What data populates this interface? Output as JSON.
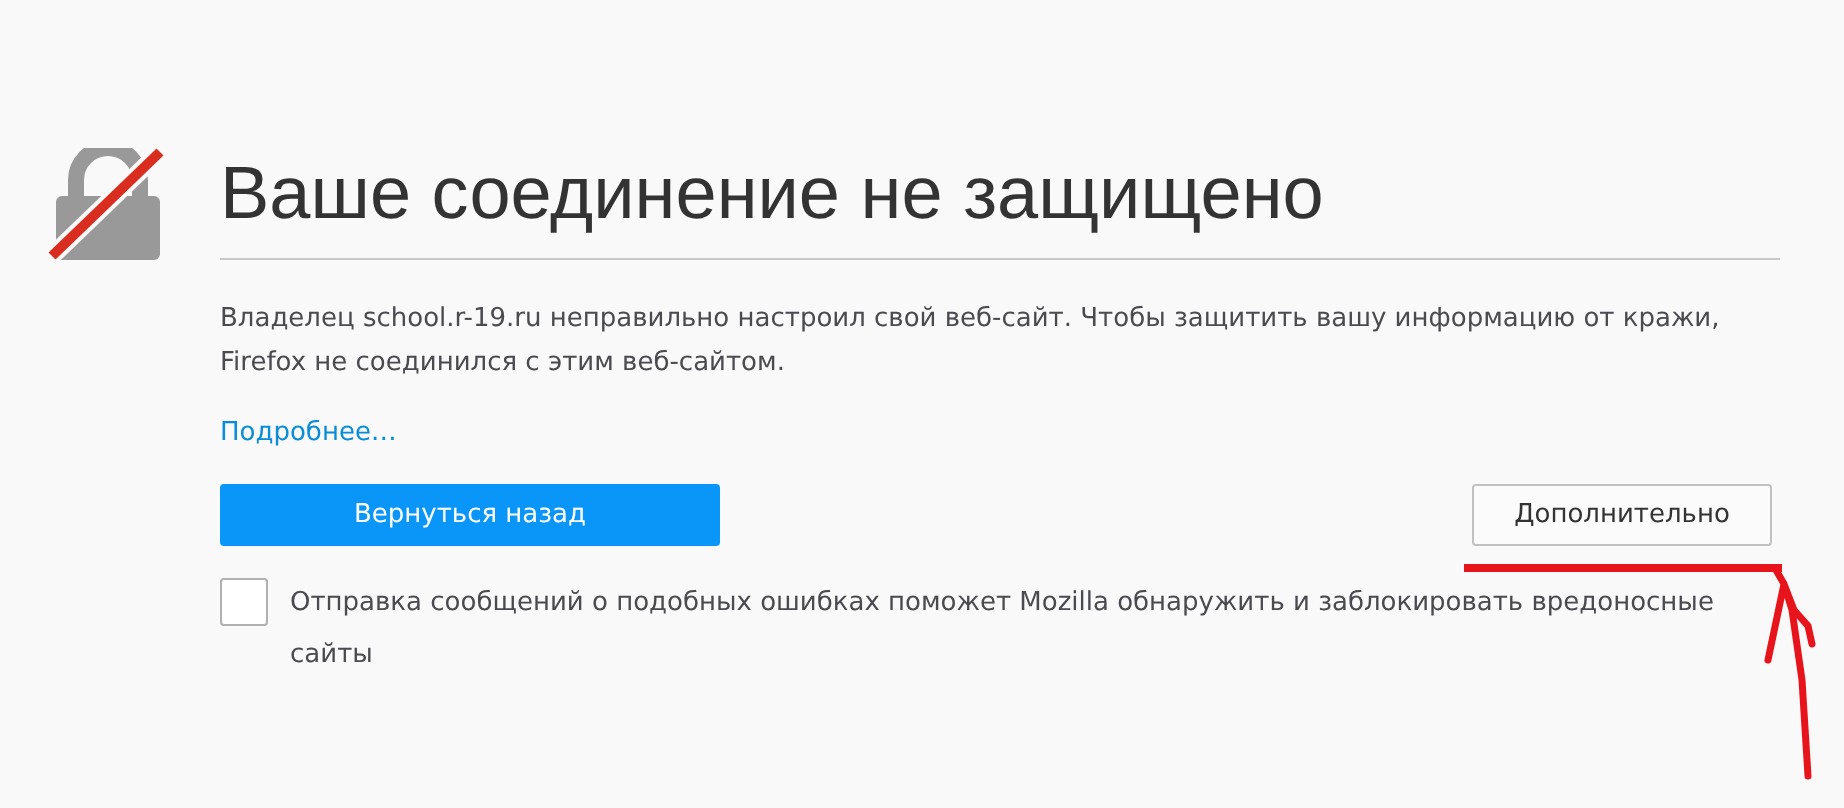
{
  "title": "Ваше соединение не защищено",
  "message": "Владелец school.r-19.ru неправильно настроил свой веб-сайт. Чтобы защитить вашу информацию от кражи, Firefox не соединился с этим веб-сайтом.",
  "details_link": "Подробнее…",
  "buttons": [
    {
      "label": "Вернуться назад",
      "kind": "primary"
    },
    {
      "label": "Дополнительно",
      "kind": "secondary"
    }
  ],
  "report_checkbox": {
    "label": "Отправка сообщений о подобных ошибках поможет Mozilla обнаружить и заблокировать вредоносные сайты",
    "checked": false
  }
}
